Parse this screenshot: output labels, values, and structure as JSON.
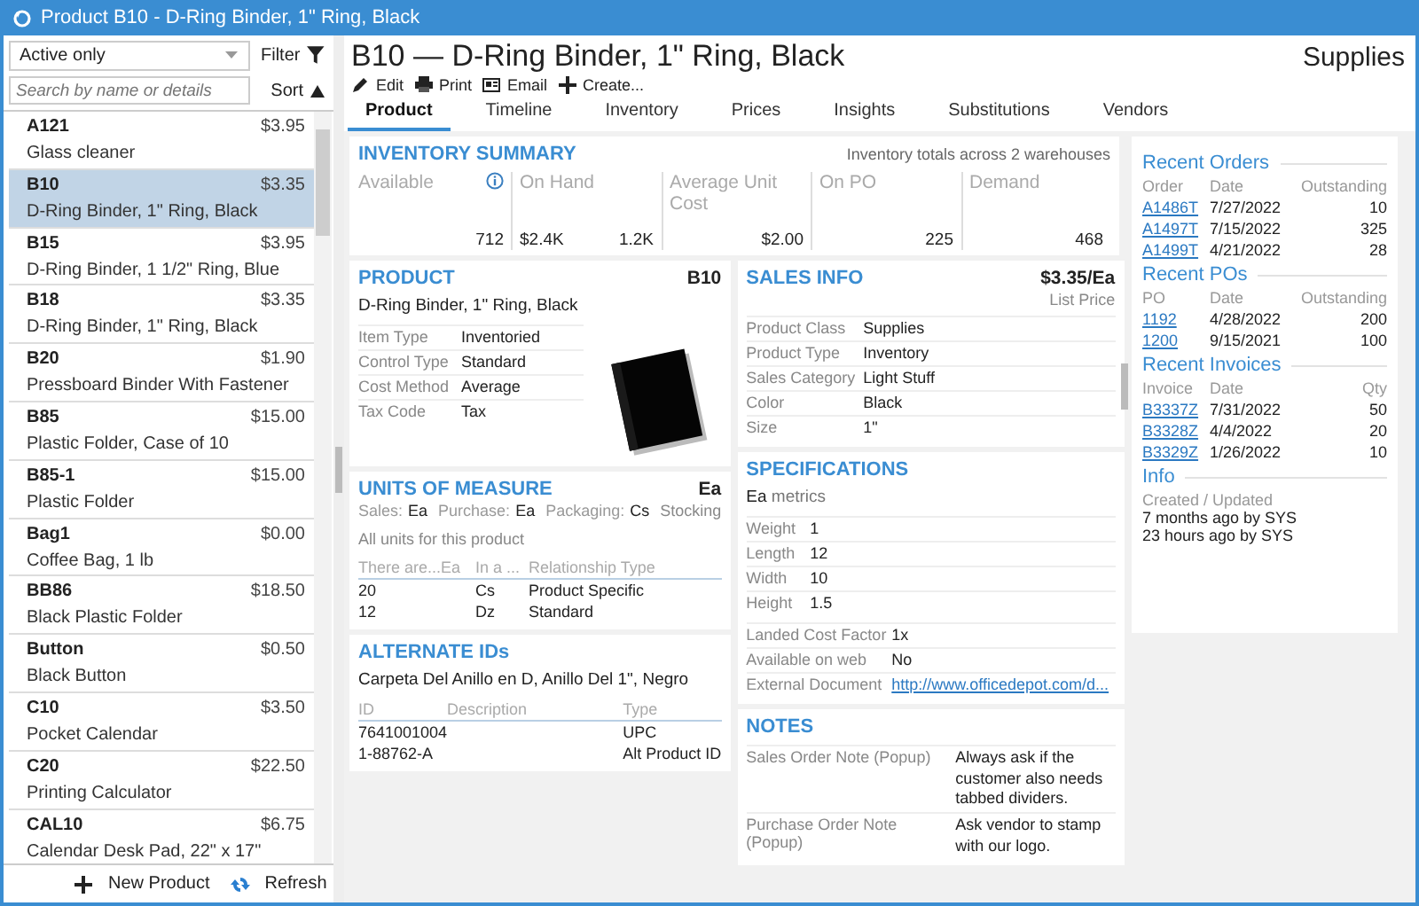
{
  "window": {
    "title": "Product B10 - D-Ring Binder, 1\" Ring, Black"
  },
  "sidebar": {
    "filter_value": "Active only",
    "filter_label": "Filter",
    "search_placeholder": "Search by name or details",
    "sort_label": "Sort",
    "items": [
      {
        "code": "A121",
        "price": "$3.95",
        "description": "Glass cleaner",
        "selected": false
      },
      {
        "code": "B10",
        "price": "$3.35",
        "description": "D-Ring Binder, 1\" Ring, Black",
        "selected": true
      },
      {
        "code": "B15",
        "price": "$3.95",
        "description": "D-Ring Binder, 1 1/2\" Ring, Blue",
        "selected": false
      },
      {
        "code": "B18",
        "price": "$3.35",
        "description": "D-Ring Binder, 1\" Ring, Black",
        "selected": false
      },
      {
        "code": "B20",
        "price": "$1.90",
        "description": "Pressboard Binder With Fastener",
        "selected": false
      },
      {
        "code": "B85",
        "price": "$15.00",
        "description": "Plastic Folder, Case of 10",
        "selected": false
      },
      {
        "code": "B85-1",
        "price": "$15.00",
        "description": "Plastic Folder",
        "selected": false
      },
      {
        "code": "Bag1",
        "price": "$0.00",
        "description": "Coffee Bag, 1 lb",
        "selected": false
      },
      {
        "code": "BB86",
        "price": "$18.50",
        "description": "Black Plastic Folder",
        "selected": false
      },
      {
        "code": "Button",
        "price": "$0.50",
        "description": "Black Button",
        "selected": false
      },
      {
        "code": "C10",
        "price": "$3.50",
        "description": "Pocket Calendar",
        "selected": false
      },
      {
        "code": "C20",
        "price": "$22.50",
        "description": "Printing Calculator",
        "selected": false
      },
      {
        "code": "CAL10",
        "price": "$6.75",
        "description": "Calendar Desk Pad, 22\" x 17\"",
        "selected": false
      }
    ],
    "footer": [
      "New Product",
      "Refresh"
    ]
  },
  "header": {
    "title": "B10 — D-Ring Binder, 1\" Ring, Black",
    "category": "Supplies",
    "actions": [
      "Edit",
      "Print",
      "Email",
      "Create..."
    ]
  },
  "tabs": [
    {
      "label": "Product",
      "selected": true
    },
    {
      "label": "Timeline",
      "selected": false
    },
    {
      "label": "Inventory",
      "selected": false
    },
    {
      "label": "Prices",
      "selected": false
    },
    {
      "label": "Insights",
      "selected": false
    },
    {
      "label": "Substitutions",
      "selected": false
    },
    {
      "label": "Vendors",
      "selected": false
    }
  ],
  "inventory_summary": {
    "title": "INVENTORY SUMMARY",
    "note": "Inventory totals across 2 warehouses",
    "metrics": [
      {
        "label": "Available",
        "values": [
          "712"
        ],
        "info": true
      },
      {
        "label": "On Hand",
        "values": [
          "$2.4K",
          "1.2K"
        ],
        "info": false
      },
      {
        "label": "Average Unit Cost",
        "values": [
          "$2.00"
        ],
        "info": false
      },
      {
        "label": "On PO",
        "values": [
          "225"
        ],
        "info": false
      },
      {
        "label": "Demand",
        "values": [
          "468"
        ],
        "info": false
      }
    ]
  },
  "product": {
    "title": "PRODUCT",
    "code": "B10",
    "name": "D-Ring Binder, 1\" Ring, Black",
    "fields": [
      {
        "label": "Item Type",
        "value": "Inventoried"
      },
      {
        "label": "Control Type",
        "value": "Standard"
      },
      {
        "label": "Cost Method",
        "value": "Average"
      },
      {
        "label": "Tax Code",
        "value": "Tax"
      }
    ]
  },
  "units_of_measure": {
    "title": "UNITS OF MEASURE",
    "unit": "Ea",
    "summary": [
      {
        "label": "Sales:",
        "value": "Ea"
      },
      {
        "label": "Purchase:",
        "value": "Ea"
      },
      {
        "label": "Packaging:",
        "value": "Cs"
      }
    ],
    "stocking": "Stocking",
    "caption": "All units for this product",
    "columns": [
      "There are...Ea",
      "In a ...",
      "Relationship Type"
    ],
    "rows": [
      [
        "20",
        "Cs",
        "Product Specific"
      ],
      [
        "12",
        "Dz",
        "Standard"
      ]
    ]
  },
  "alternate_ids": {
    "title": "ALTERNATE IDs",
    "description": "Carpeta Del Anillo en D, Anillo Del 1\", Negro",
    "columns": [
      "ID",
      "Description",
      "Type"
    ],
    "rows": [
      [
        "7641001004",
        "",
        "UPC"
      ],
      [
        "1-88762-A",
        "",
        "Alt Product ID"
      ]
    ]
  },
  "sales_info": {
    "title": "SALES INFO",
    "price": "$3.35/Ea",
    "price_label": "List Price",
    "fields": [
      {
        "label": "Product Class",
        "value": "Supplies"
      },
      {
        "label": "Product Type",
        "value": "Inventory"
      },
      {
        "label": "Sales Category",
        "value": "Light Stuff"
      },
      {
        "label": "Color",
        "value": "Black"
      },
      {
        "label": "Size",
        "value": "1\""
      }
    ]
  },
  "specifications": {
    "title": "SPECIFICATIONS",
    "unit": "Ea",
    "unit_caption": "metrics",
    "metrics": [
      {
        "label": "Weight",
        "value": "1"
      },
      {
        "label": "Length",
        "value": "12"
      },
      {
        "label": "Width",
        "value": "10"
      },
      {
        "label": "Height",
        "value": "1.5"
      }
    ],
    "fields": [
      {
        "label": "Landed Cost Factor",
        "value": "1x",
        "kind": "text"
      },
      {
        "label": "Available on web",
        "value": "No",
        "kind": "text"
      },
      {
        "label": "External Document",
        "value": "http://www.officedepot.com/d...",
        "kind": "link"
      }
    ]
  },
  "notes": {
    "title": "NOTES",
    "fields": [
      {
        "label": "Sales Order Note (Popup)",
        "value": "Always ask if the customer also needs tabbed dividers."
      },
      {
        "label": "Purchase Order Note (Popup)",
        "value": "Ask vendor to stamp with our logo."
      }
    ]
  },
  "recent": [
    {
      "title": "Recent Orders",
      "columns": [
        "Order",
        "Date",
        "Outstanding"
      ],
      "rows": [
        [
          "A1486T",
          "7/27/2022",
          "10"
        ],
        [
          "A1497T",
          "7/15/2022",
          "325"
        ],
        [
          "A1499T",
          "4/21/2022",
          "28"
        ]
      ]
    },
    {
      "title": "Recent POs",
      "columns": [
        "PO",
        "Date",
        "Outstanding"
      ],
      "rows": [
        [
          "1192",
          "4/28/2022",
          "200"
        ],
        [
          "1200",
          "9/15/2021",
          "100"
        ]
      ]
    },
    {
      "title": "Recent Invoices",
      "columns": [
        "Invoice",
        "Date",
        "Qty"
      ],
      "rows": [
        [
          "B3337Z",
          "7/31/2022",
          "50"
        ],
        [
          "B3328Z",
          "4/4/2022",
          "20"
        ],
        [
          "B3329Z",
          "1/26/2022",
          "10"
        ]
      ]
    }
  ],
  "info": {
    "title": "Info",
    "caption": "Created / Updated",
    "lines": [
      "7 months ago by SYS",
      "23 hours ago by SYS"
    ]
  }
}
